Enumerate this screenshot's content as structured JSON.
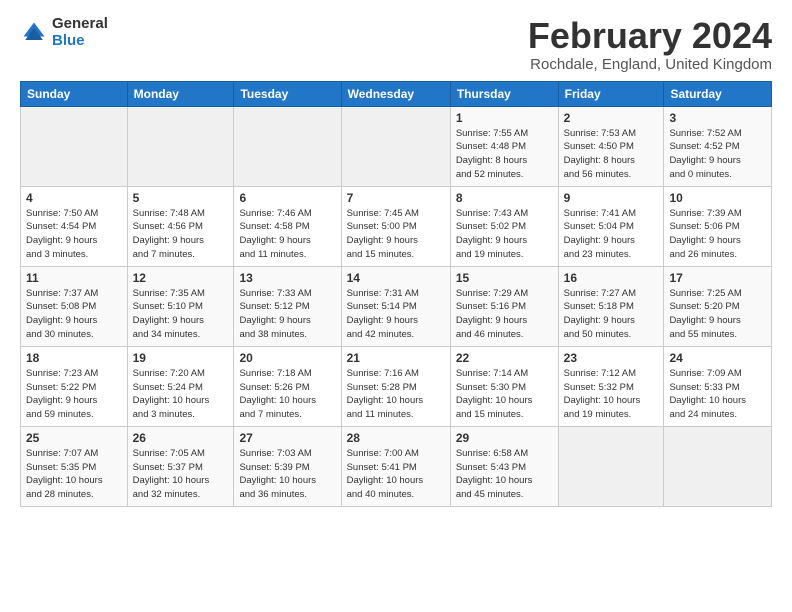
{
  "logo": {
    "general": "General",
    "blue": "Blue"
  },
  "title": {
    "month": "February 2024",
    "location": "Rochdale, England, United Kingdom"
  },
  "headers": [
    "Sunday",
    "Monday",
    "Tuesday",
    "Wednesday",
    "Thursday",
    "Friday",
    "Saturday"
  ],
  "weeks": [
    [
      {
        "day": "",
        "info": ""
      },
      {
        "day": "",
        "info": ""
      },
      {
        "day": "",
        "info": ""
      },
      {
        "day": "",
        "info": ""
      },
      {
        "day": "1",
        "info": "Sunrise: 7:55 AM\nSunset: 4:48 PM\nDaylight: 8 hours\nand 52 minutes."
      },
      {
        "day": "2",
        "info": "Sunrise: 7:53 AM\nSunset: 4:50 PM\nDaylight: 8 hours\nand 56 minutes."
      },
      {
        "day": "3",
        "info": "Sunrise: 7:52 AM\nSunset: 4:52 PM\nDaylight: 9 hours\nand 0 minutes."
      }
    ],
    [
      {
        "day": "4",
        "info": "Sunrise: 7:50 AM\nSunset: 4:54 PM\nDaylight: 9 hours\nand 3 minutes."
      },
      {
        "day": "5",
        "info": "Sunrise: 7:48 AM\nSunset: 4:56 PM\nDaylight: 9 hours\nand 7 minutes."
      },
      {
        "day": "6",
        "info": "Sunrise: 7:46 AM\nSunset: 4:58 PM\nDaylight: 9 hours\nand 11 minutes."
      },
      {
        "day": "7",
        "info": "Sunrise: 7:45 AM\nSunset: 5:00 PM\nDaylight: 9 hours\nand 15 minutes."
      },
      {
        "day": "8",
        "info": "Sunrise: 7:43 AM\nSunset: 5:02 PM\nDaylight: 9 hours\nand 19 minutes."
      },
      {
        "day": "9",
        "info": "Sunrise: 7:41 AM\nSunset: 5:04 PM\nDaylight: 9 hours\nand 23 minutes."
      },
      {
        "day": "10",
        "info": "Sunrise: 7:39 AM\nSunset: 5:06 PM\nDaylight: 9 hours\nand 26 minutes."
      }
    ],
    [
      {
        "day": "11",
        "info": "Sunrise: 7:37 AM\nSunset: 5:08 PM\nDaylight: 9 hours\nand 30 minutes."
      },
      {
        "day": "12",
        "info": "Sunrise: 7:35 AM\nSunset: 5:10 PM\nDaylight: 9 hours\nand 34 minutes."
      },
      {
        "day": "13",
        "info": "Sunrise: 7:33 AM\nSunset: 5:12 PM\nDaylight: 9 hours\nand 38 minutes."
      },
      {
        "day": "14",
        "info": "Sunrise: 7:31 AM\nSunset: 5:14 PM\nDaylight: 9 hours\nand 42 minutes."
      },
      {
        "day": "15",
        "info": "Sunrise: 7:29 AM\nSunset: 5:16 PM\nDaylight: 9 hours\nand 46 minutes."
      },
      {
        "day": "16",
        "info": "Sunrise: 7:27 AM\nSunset: 5:18 PM\nDaylight: 9 hours\nand 50 minutes."
      },
      {
        "day": "17",
        "info": "Sunrise: 7:25 AM\nSunset: 5:20 PM\nDaylight: 9 hours\nand 55 minutes."
      }
    ],
    [
      {
        "day": "18",
        "info": "Sunrise: 7:23 AM\nSunset: 5:22 PM\nDaylight: 9 hours\nand 59 minutes."
      },
      {
        "day": "19",
        "info": "Sunrise: 7:20 AM\nSunset: 5:24 PM\nDaylight: 10 hours\nand 3 minutes."
      },
      {
        "day": "20",
        "info": "Sunrise: 7:18 AM\nSunset: 5:26 PM\nDaylight: 10 hours\nand 7 minutes."
      },
      {
        "day": "21",
        "info": "Sunrise: 7:16 AM\nSunset: 5:28 PM\nDaylight: 10 hours\nand 11 minutes."
      },
      {
        "day": "22",
        "info": "Sunrise: 7:14 AM\nSunset: 5:30 PM\nDaylight: 10 hours\nand 15 minutes."
      },
      {
        "day": "23",
        "info": "Sunrise: 7:12 AM\nSunset: 5:32 PM\nDaylight: 10 hours\nand 19 minutes."
      },
      {
        "day": "24",
        "info": "Sunrise: 7:09 AM\nSunset: 5:33 PM\nDaylight: 10 hours\nand 24 minutes."
      }
    ],
    [
      {
        "day": "25",
        "info": "Sunrise: 7:07 AM\nSunset: 5:35 PM\nDaylight: 10 hours\nand 28 minutes."
      },
      {
        "day": "26",
        "info": "Sunrise: 7:05 AM\nSunset: 5:37 PM\nDaylight: 10 hours\nand 32 minutes."
      },
      {
        "day": "27",
        "info": "Sunrise: 7:03 AM\nSunset: 5:39 PM\nDaylight: 10 hours\nand 36 minutes."
      },
      {
        "day": "28",
        "info": "Sunrise: 7:00 AM\nSunset: 5:41 PM\nDaylight: 10 hours\nand 40 minutes."
      },
      {
        "day": "29",
        "info": "Sunrise: 6:58 AM\nSunset: 5:43 PM\nDaylight: 10 hours\nand 45 minutes."
      },
      {
        "day": "",
        "info": ""
      },
      {
        "day": "",
        "info": ""
      }
    ]
  ]
}
